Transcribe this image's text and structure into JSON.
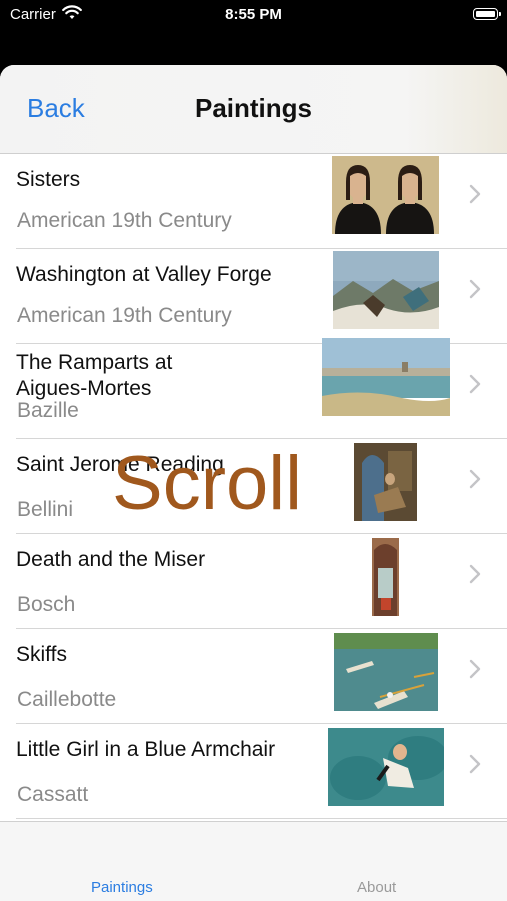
{
  "status_bar": {
    "carrier": "Carrier",
    "time": "8:55 PM"
  },
  "nav": {
    "back_label": "Back",
    "title": "Paintings"
  },
  "paintings": [
    {
      "title": "Sisters",
      "artist": "American 19th Century"
    },
    {
      "title": "Washington at Valley Forge",
      "artist": "American 19th Century"
    },
    {
      "title": "The Ramparts at Aigues-Mortes",
      "artist": "Bazille"
    },
    {
      "title": "Saint Jerome Reading",
      "artist": "Bellini"
    },
    {
      "title": "Death and the Miser",
      "artist": "Bosch"
    },
    {
      "title": "Skiffs",
      "artist": "Caillebotte"
    },
    {
      "title": "Little Girl in a Blue Armchair",
      "artist": "Cassatt"
    }
  ],
  "overlay": {
    "text": "Scroll"
  },
  "tabs": {
    "paintings": "Paintings",
    "about": "About"
  },
  "colors": {
    "accent": "#2b7de1",
    "overlay": "#a0581d"
  }
}
